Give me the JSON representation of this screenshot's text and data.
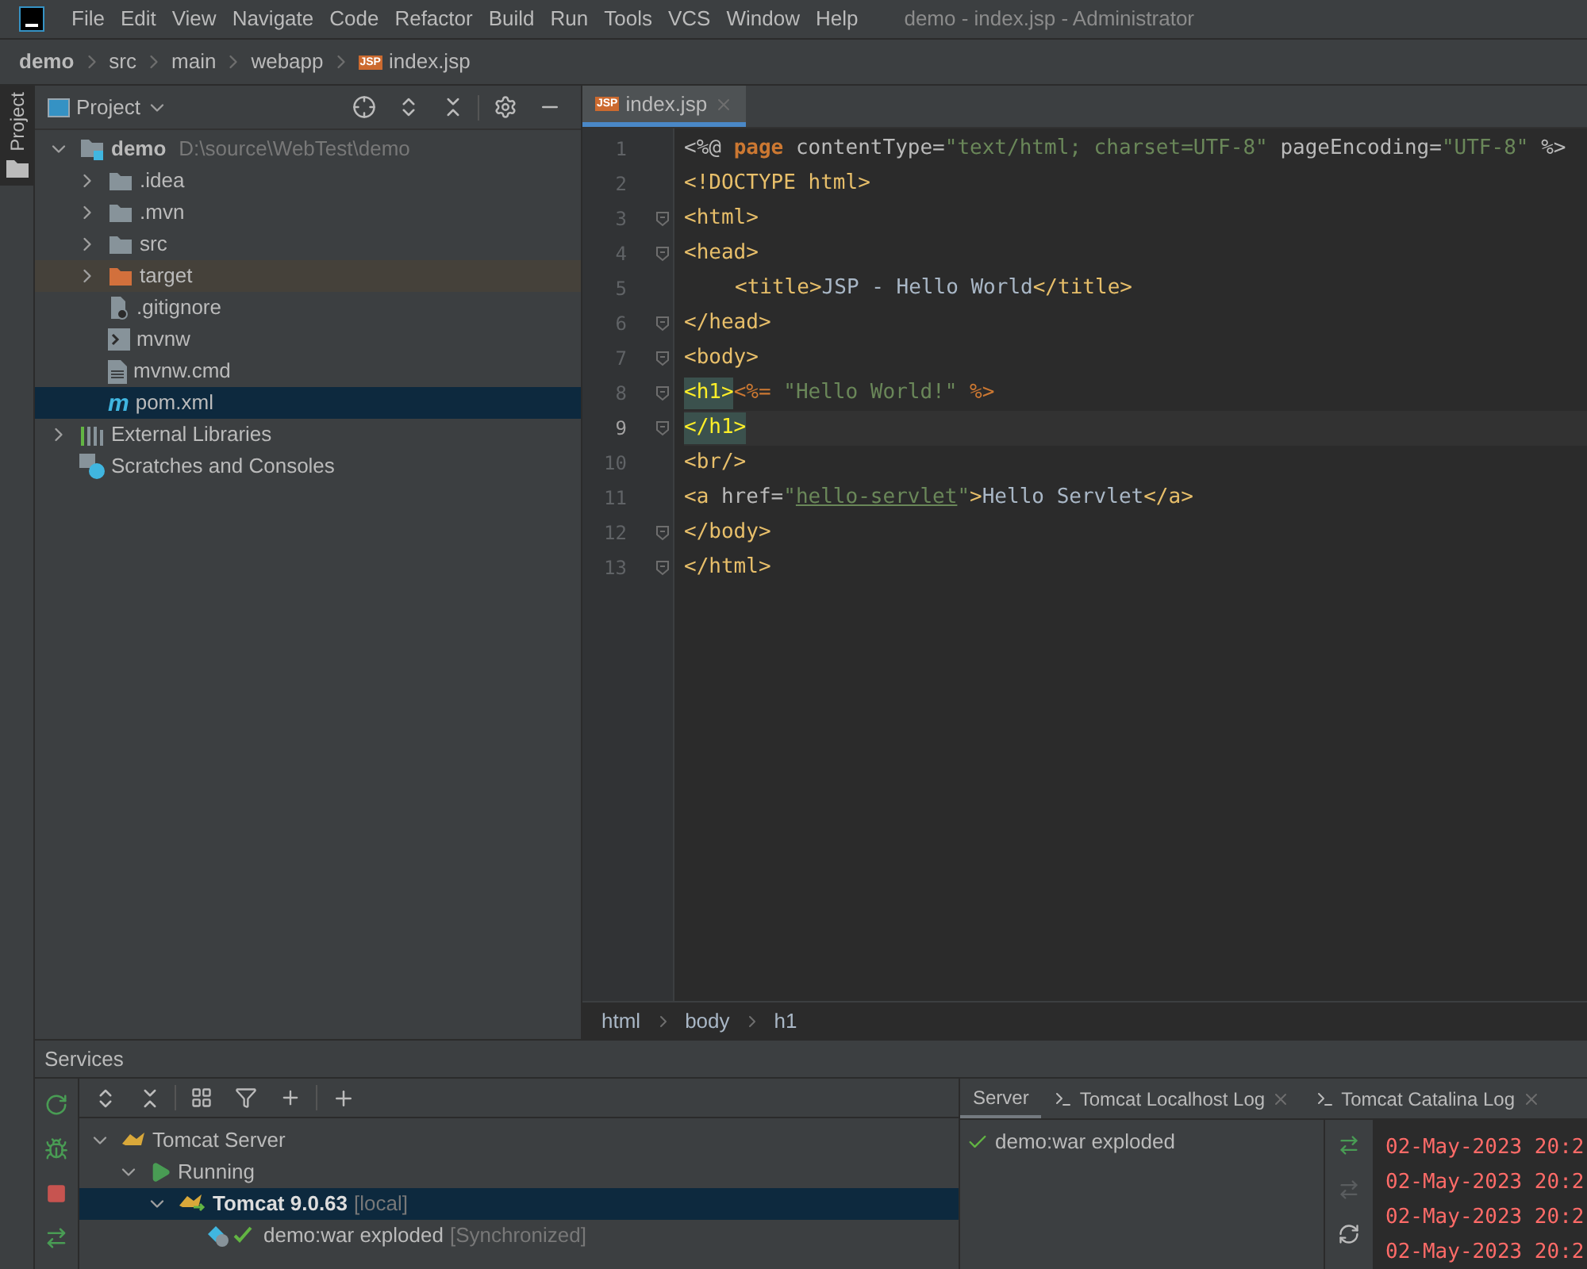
{
  "window": {
    "title": "demo - index.jsp - Administrator"
  },
  "menu": [
    "File",
    "Edit",
    "View",
    "Navigate",
    "Code",
    "Refactor",
    "Build",
    "Run",
    "Tools",
    "VCS",
    "Window",
    "Help"
  ],
  "breadcrumb": [
    {
      "label": "demo"
    },
    {
      "label": "src"
    },
    {
      "label": "main"
    },
    {
      "label": "webapp"
    },
    {
      "label": "index.jsp",
      "icon_text": "JSP"
    }
  ],
  "left_stripe": {
    "tab": "Project"
  },
  "project_panel": {
    "title": "Project",
    "tree": [
      {
        "kind": "module",
        "label": "demo",
        "hint": "D:\\source\\WebTest\\demo",
        "expanded": true,
        "selected": false,
        "children": [
          {
            "kind": "folder",
            "label": ".idea",
            "expanded": false,
            "selected": false
          },
          {
            "kind": "folder",
            "label": ".mvn",
            "expanded": false,
            "selected": false
          },
          {
            "kind": "folder",
            "label": "src",
            "expanded": false,
            "selected": false
          },
          {
            "kind": "excluded_folder",
            "label": "target",
            "expanded": false,
            "selected": false
          },
          {
            "kind": "ignore_file",
            "label": ".gitignore",
            "selected": false
          },
          {
            "kind": "script",
            "label": "mvnw",
            "selected": false
          },
          {
            "kind": "text_file",
            "label": "mvnw.cmd",
            "selected": false
          },
          {
            "kind": "maven",
            "label": "pom.xml",
            "icon_text": "m",
            "selected": true
          }
        ]
      },
      {
        "kind": "libraries",
        "label": "External Libraries",
        "expanded": false,
        "selected": false
      },
      {
        "kind": "scratches",
        "label": "Scratches and Consoles",
        "selected": false
      }
    ]
  },
  "editor": {
    "tabs": [
      {
        "label": "index.jsp",
        "icon_text": "JSP",
        "selected": true
      }
    ],
    "lines": [
      {
        "number": "1",
        "fold": false,
        "current": false,
        "indented": false,
        "tokens": [
          {
            "kind": "plain",
            "text": "<%@ "
          },
          {
            "kind": "keyword",
            "text": "page"
          },
          {
            "kind": "plain",
            "text": " contentType="
          },
          {
            "kind": "string",
            "text": "\"text/html; charset=UTF-8\""
          },
          {
            "kind": "plain",
            "text": " pageEncoding="
          },
          {
            "kind": "string",
            "text": "\"UTF-8\""
          },
          {
            "kind": "plain",
            "text": " %>"
          }
        ]
      },
      {
        "number": "2",
        "fold": false,
        "current": false,
        "indented": false,
        "tokens": [
          {
            "kind": "tag",
            "text": "<!DOCTYPE html>"
          }
        ]
      },
      {
        "number": "3",
        "fold": true,
        "current": false,
        "indented": false,
        "tokens": [
          {
            "kind": "tag",
            "text": "<html>"
          }
        ]
      },
      {
        "number": "4",
        "fold": true,
        "current": false,
        "indented": false,
        "tokens": [
          {
            "kind": "tag",
            "text": "<head>"
          }
        ]
      },
      {
        "number": "5",
        "fold": false,
        "current": false,
        "indented": true,
        "tokens": [
          {
            "kind": "tag",
            "text": "<title>"
          },
          {
            "kind": "text",
            "text": "JSP - Hello World"
          },
          {
            "kind": "tag",
            "text": "</title>"
          }
        ]
      },
      {
        "number": "6",
        "fold": true,
        "current": false,
        "indented": false,
        "tokens": [
          {
            "kind": "tag",
            "text": "</head>"
          }
        ]
      },
      {
        "number": "7",
        "fold": true,
        "current": false,
        "indented": false,
        "tokens": [
          {
            "kind": "tag",
            "text": "<body>"
          }
        ]
      },
      {
        "number": "8",
        "fold": true,
        "current": false,
        "indented": false,
        "tokens": [
          {
            "kind": "matched_tag",
            "text": "<h1>"
          },
          {
            "kind": "directive",
            "text": "<%= "
          },
          {
            "kind": "string",
            "text": "\"Hello World!\""
          },
          {
            "kind": "directive",
            "text": " %>"
          }
        ]
      },
      {
        "number": "9",
        "fold": true,
        "current": true,
        "indented": false,
        "tokens": [
          {
            "kind": "matched_tag",
            "text": "</h1>"
          }
        ]
      },
      {
        "number": "10",
        "fold": false,
        "current": false,
        "indented": false,
        "tokens": [
          {
            "kind": "tag",
            "text": "<br/>"
          }
        ]
      },
      {
        "number": "11",
        "fold": false,
        "current": false,
        "indented": false,
        "tokens": [
          {
            "kind": "tag",
            "text": "<a "
          },
          {
            "kind": "attr",
            "text": "href="
          },
          {
            "kind": "string",
            "text": "\""
          },
          {
            "kind": "link",
            "text": "hello-servlet"
          },
          {
            "kind": "string",
            "text": "\""
          },
          {
            "kind": "tag",
            "text": ">"
          },
          {
            "kind": "text",
            "text": "Hello Servlet"
          },
          {
            "kind": "tag",
            "text": "</a>"
          }
        ]
      },
      {
        "number": "12",
        "fold": true,
        "current": false,
        "indented": false,
        "tokens": [
          {
            "kind": "tag",
            "text": "</body>"
          }
        ]
      },
      {
        "number": "13",
        "fold": true,
        "current": false,
        "indented": false,
        "tokens": [
          {
            "kind": "tag",
            "text": "</html>"
          }
        ]
      }
    ],
    "path": [
      "html",
      "body",
      "h1"
    ]
  },
  "services": {
    "title": "Services",
    "tree": [
      {
        "kind": "server",
        "label": "Tomcat Server",
        "expanded": true,
        "selected": false,
        "children": [
          {
            "kind": "running",
            "label": "Running",
            "expanded": true,
            "selected": false,
            "children": [
              {
                "kind": "instance",
                "label": "Tomcat 9.0.63",
                "hint": "[local]",
                "expanded": true,
                "selected": true,
                "children": [
                  {
                    "kind": "artifact",
                    "label": "demo:war exploded",
                    "hint": "[Synchronized]",
                    "selected": false
                  }
                ]
              }
            ]
          }
        ]
      }
    ],
    "tabs": [
      {
        "label": "Server",
        "selected": true,
        "closable": false
      },
      {
        "label": "Tomcat Localhost Log",
        "selected": false,
        "closable": true
      },
      {
        "label": "Tomcat Catalina Log",
        "selected": false,
        "closable": true
      }
    ],
    "deployments": [
      {
        "label": "demo:war exploded",
        "ok": true
      }
    ],
    "log": [
      "02-May-2023 20:2",
      "02-May-2023 20:2",
      "02-May-2023 20:2",
      "02-May-2023 20:2"
    ]
  }
}
